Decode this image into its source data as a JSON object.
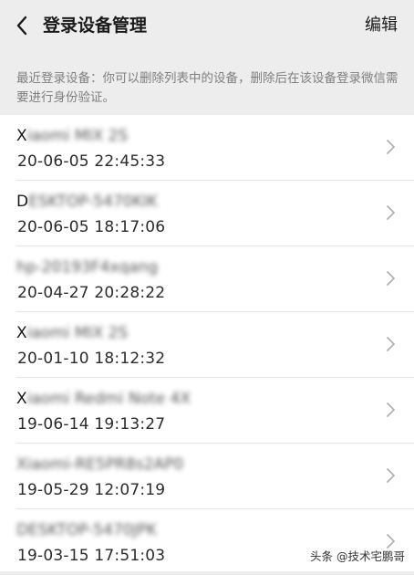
{
  "header": {
    "title": "登录设备管理",
    "edit_label": "编辑"
  },
  "notice": "最近登录设备：你可以删除列表中的设备，删除后在该设备登录微信需要进行身份验证。",
  "devices": [
    {
      "name_prefix": "X",
      "name_obscured": "iaomi MIX 2S",
      "time": "20-06-05 22:45:33"
    },
    {
      "name_prefix": "D",
      "name_obscured": "ESKTOP-5470KIK",
      "time": "20-06-05 18:17:06"
    },
    {
      "name_prefix": "",
      "name_obscured": "hp-20193F4xqang",
      "time": "20-04-27 20:28:22"
    },
    {
      "name_prefix": "X",
      "name_obscured": "iaomi MIX 2S",
      "time": "20-01-10 18:12:32"
    },
    {
      "name_prefix": "X",
      "name_obscured": "iaomi Redmi Note 4X",
      "time": "19-06-14 19:13:27"
    },
    {
      "name_prefix": "",
      "name_obscured": "Xiaomi-RE5PR8s2AP0",
      "time": "19-05-29 12:07:19"
    },
    {
      "name_prefix": "",
      "name_obscured": "DESKTOP-5470JPK",
      "time": "19-03-15 17:51:03"
    }
  ],
  "watermark": "头条 @技术宅鹏哥",
  "colors": {
    "background": "#ededed",
    "list_background": "#ffffff",
    "notice_text": "#7f7f7f",
    "chevron": "#b2b2b2"
  },
  "icons": {
    "back": "chevron-left-icon",
    "row_arrow": "chevron-right-icon"
  }
}
